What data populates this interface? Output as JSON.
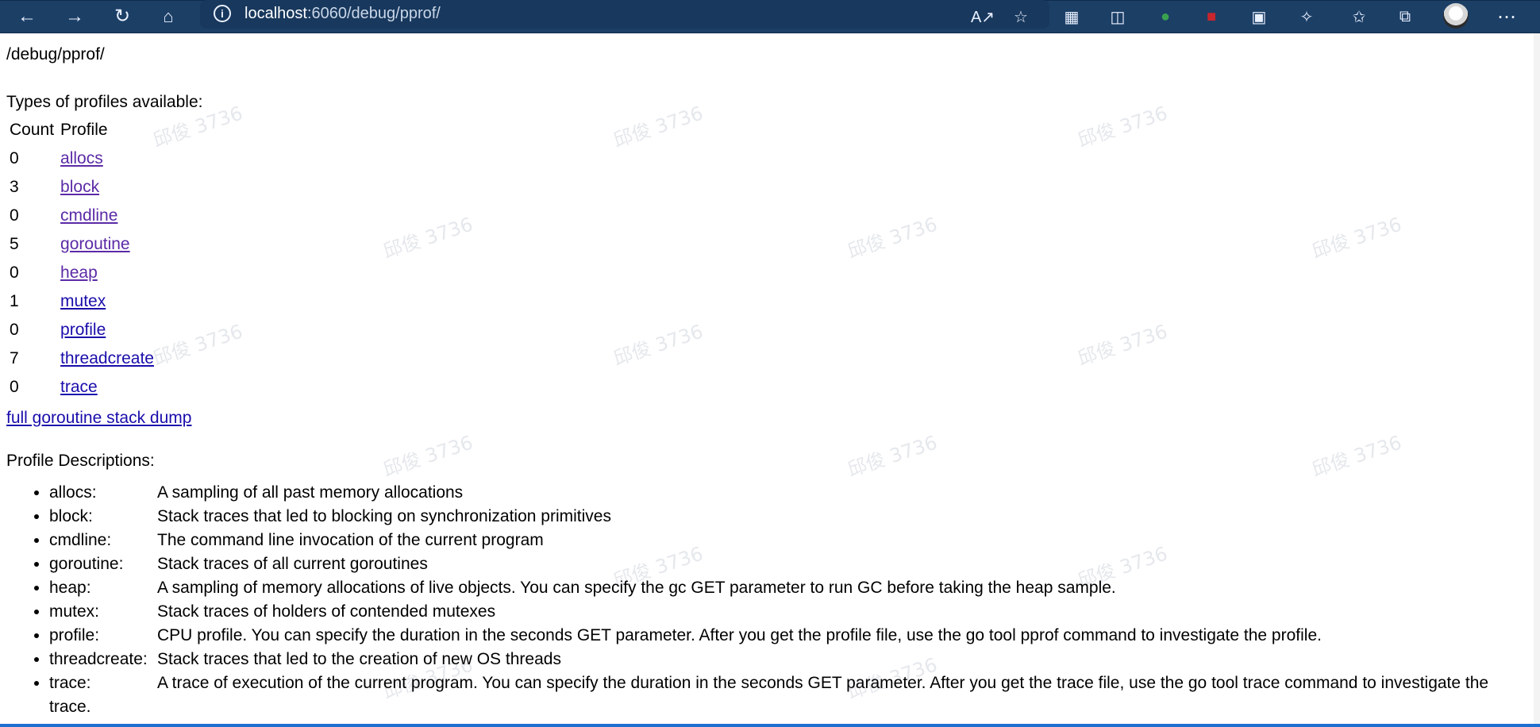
{
  "browser": {
    "url": {
      "host": "localhost",
      "rest": ":6060/debug/pprof/"
    },
    "icons": {
      "back": "arrow-left-icon",
      "forward": "arrow-right-icon",
      "refresh": "refresh-icon",
      "home": "home-icon",
      "info": "info-icon",
      "read_aloud": "read-aloud-icon",
      "favorite_add": "favorite-add-icon",
      "collections": "collections-icon",
      "extensions": "extensions-icon",
      "favorites": "favorites-icon",
      "more": "more-icon"
    },
    "extensions": [
      {
        "name": "extension-screen-icon"
      },
      {
        "name": "extension-shield-icon"
      },
      {
        "name": "extension-evernote-icon"
      },
      {
        "name": "extension-ublock-icon"
      },
      {
        "name": "extension-cube-icon"
      }
    ]
  },
  "page": {
    "path": "/debug/pprof/",
    "types_heading": "Types of profiles available:",
    "table": {
      "headers": [
        "Count",
        "Profile"
      ],
      "rows": [
        {
          "count": "0",
          "profile": "allocs"
        },
        {
          "count": "3",
          "profile": "block"
        },
        {
          "count": "0",
          "profile": "cmdline"
        },
        {
          "count": "5",
          "profile": "goroutine"
        },
        {
          "count": "0",
          "profile": "heap"
        },
        {
          "count": "1",
          "profile": "mutex"
        },
        {
          "count": "0",
          "profile": "profile"
        },
        {
          "count": "7",
          "profile": "threadcreate"
        },
        {
          "count": "0",
          "profile": "trace"
        }
      ]
    },
    "full_dump": "full goroutine stack dump",
    "descriptions_heading": "Profile Descriptions:",
    "descriptions": [
      {
        "name": "allocs:",
        "text": "A sampling of all past memory allocations"
      },
      {
        "name": "block:",
        "text": "Stack traces that led to blocking on synchronization primitives"
      },
      {
        "name": "cmdline:",
        "text": "The command line invocation of the current program"
      },
      {
        "name": "goroutine:",
        "text": "Stack traces of all current goroutines"
      },
      {
        "name": "heap:",
        "text": "A sampling of memory allocations of live objects. You can specify the gc GET parameter to run GC before taking the heap sample."
      },
      {
        "name": "mutex:",
        "text": "Stack traces of holders of contended mutexes"
      },
      {
        "name": "profile:",
        "text": "CPU profile. You can specify the duration in the seconds GET parameter. After you get the profile file, use the go tool pprof command to investigate the profile."
      },
      {
        "name": "threadcreate:",
        "text": "Stack traces that led to the creation of new OS threads"
      },
      {
        "name": "trace:",
        "text": "A trace of execution of the current program. You can specify the duration in the seconds GET parameter. After you get the trace file, use the go tool trace command to investigate the trace."
      }
    ],
    "watermark": "邱俊 3736"
  }
}
